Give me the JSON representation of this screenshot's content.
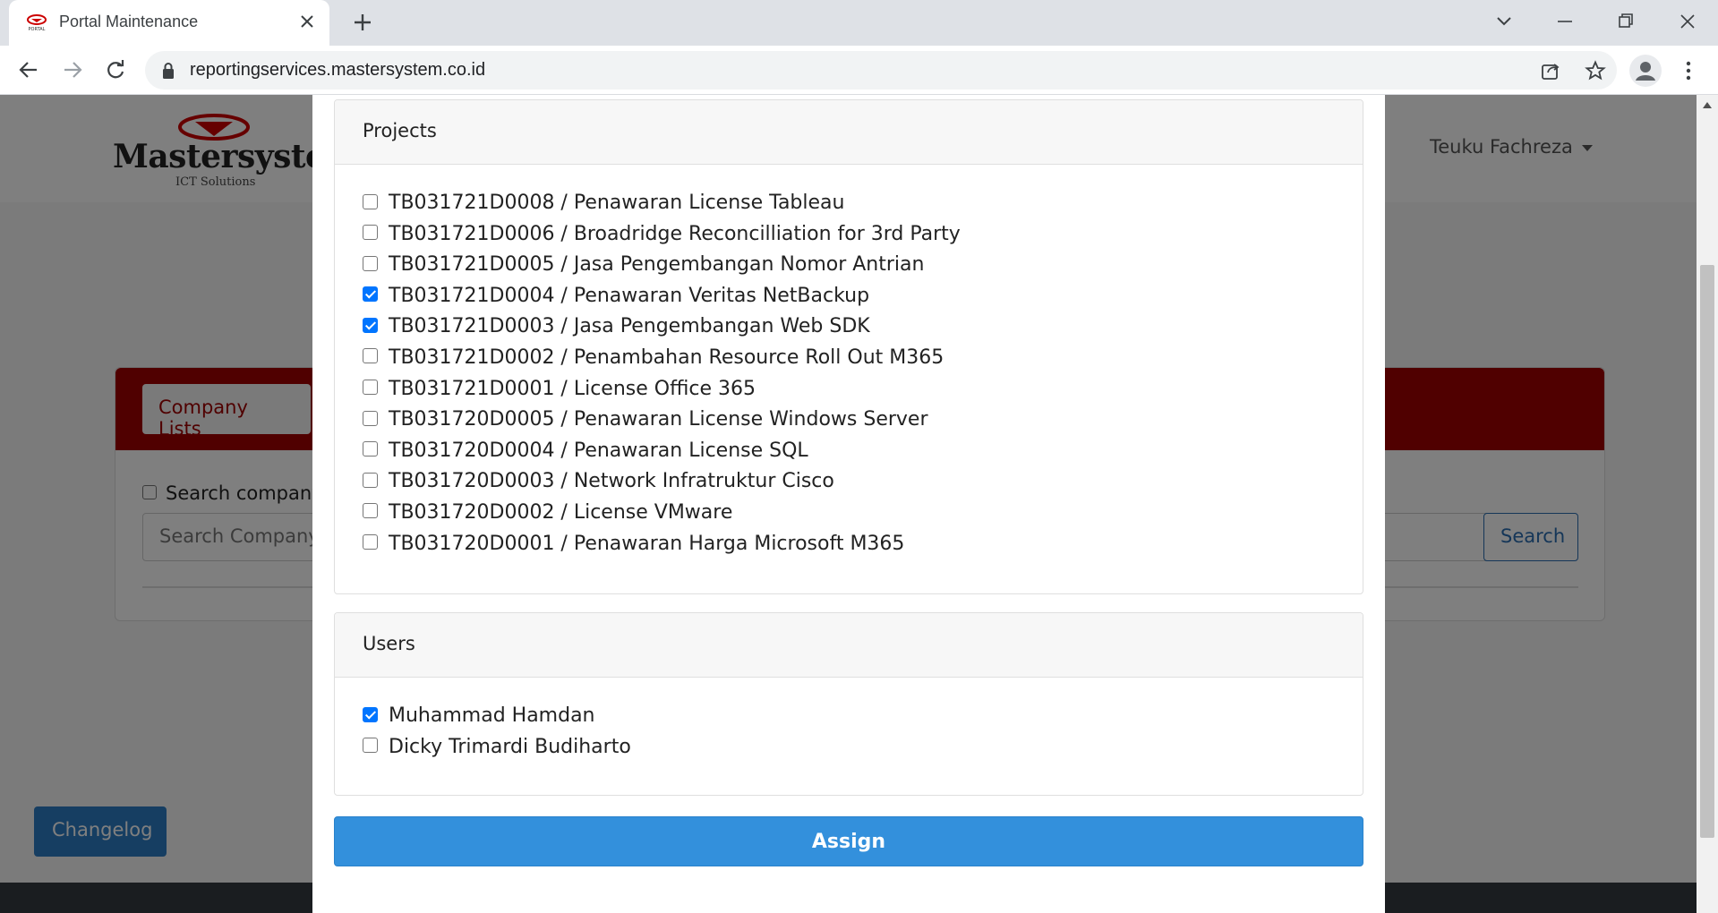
{
  "browser": {
    "tab_title": "Portal Maintenance",
    "favicon_text": "PORTAL",
    "url": "reportingservices.mastersystem.co.id"
  },
  "site": {
    "logo_text": "Mastersystem",
    "logo_sub": "ICT Solutions",
    "user_name": "Teuku Fachreza",
    "company_tab_label": "Company Lists",
    "search_checkbox_label": "Search company",
    "search_placeholder": "Search Company",
    "search_button": "Search",
    "changelog_label": "Changelog"
  },
  "modal": {
    "projects": {
      "title": "Projects",
      "items": [
        {
          "label": "TB031721D0008 / Penawaran License Tableau",
          "checked": false
        },
        {
          "label": "TB031721D0006 / Broadridge Reconcilliation for 3rd Party",
          "checked": false
        },
        {
          "label": "TB031721D0005 / Jasa Pengembangan Nomor Antrian",
          "checked": false
        },
        {
          "label": "TB031721D0004 / Penawaran Veritas NetBackup",
          "checked": true
        },
        {
          "label": "TB031721D0003 / Jasa Pengembangan Web SDK",
          "checked": true
        },
        {
          "label": "TB031721D0002 / Penambahan Resource Roll Out M365",
          "checked": false
        },
        {
          "label": "TB031721D0001 / License Office 365",
          "checked": false
        },
        {
          "label": "TB031720D0005 / Penawaran License Windows Server",
          "checked": false
        },
        {
          "label": "TB031720D0004 / Penawaran License SQL",
          "checked": false
        },
        {
          "label": "TB031720D0003 / Network Infratruktur Cisco",
          "checked": false
        },
        {
          "label": "TB031720D0002 / License VMware",
          "checked": false
        },
        {
          "label": "TB031720D0001 / Penawaran Harga Microsoft M365",
          "checked": false
        }
      ]
    },
    "users": {
      "title": "Users",
      "items": [
        {
          "label": "Muhammad Hamdan",
          "checked": true
        },
        {
          "label": "Dicky Trimardi Budiharto",
          "checked": false
        }
      ]
    },
    "assign_label": "Assign"
  },
  "colors": {
    "brand_red": "#a00000",
    "assign_blue": "#3390dc",
    "checkbox_blue": "#0075ff"
  }
}
